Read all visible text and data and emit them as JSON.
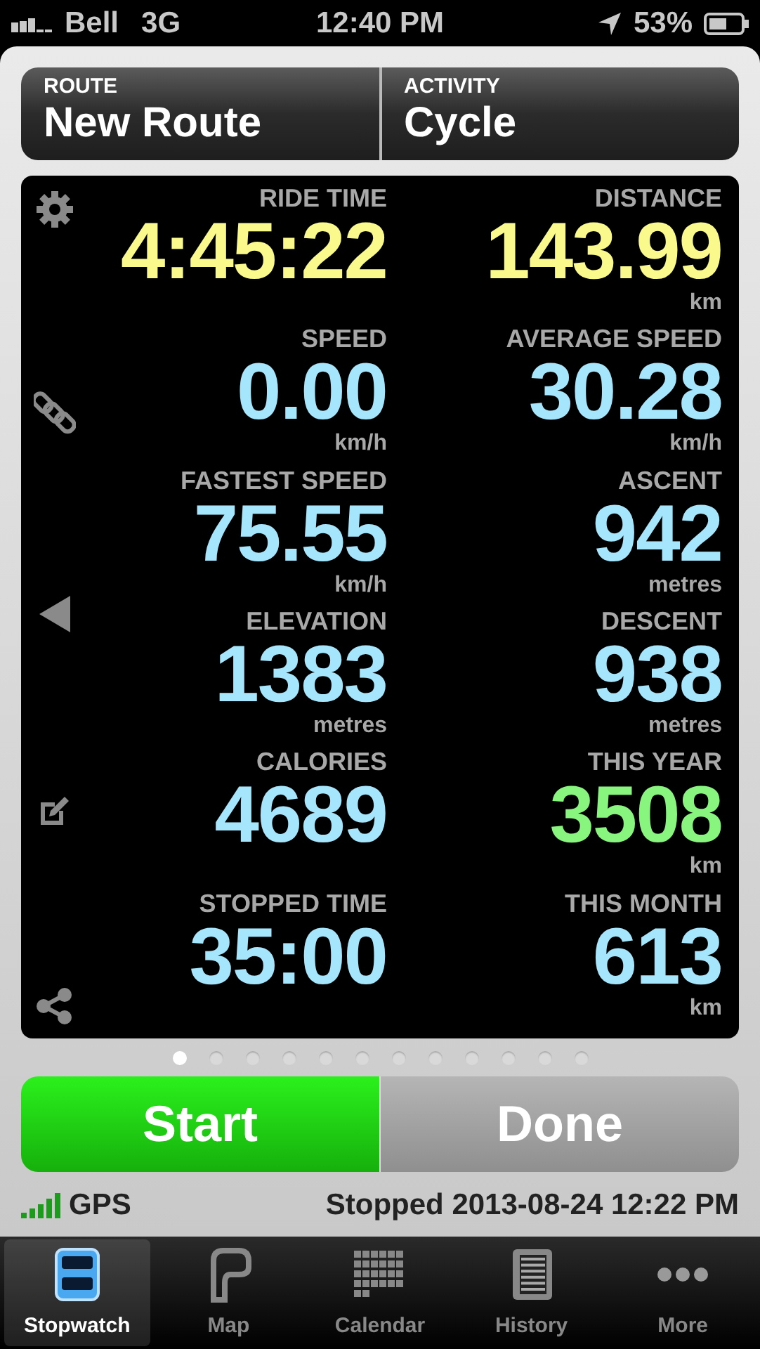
{
  "status_bar": {
    "carrier": "Bell",
    "network": "3G",
    "time": "12:40 PM",
    "battery": "53%"
  },
  "header": [
    {
      "label": "ROUTE",
      "value": "New Route"
    },
    {
      "label": "ACTIVITY",
      "value": "Cycle"
    }
  ],
  "metrics": [
    {
      "label": "RIDE TIME",
      "value": "4:45:22",
      "color": "#fafa8c"
    },
    {
      "label": "DISTANCE",
      "value": "143.99",
      "unit": "km",
      "color": "#fafa8c"
    },
    {
      "label": "SPEED",
      "value": "0.00",
      "unit": "km/h",
      "color": "#a6e6fc"
    },
    {
      "label": "AVERAGE SPEED",
      "value": "30.28",
      "unit": "km/h",
      "color": "#a6e6fc"
    },
    {
      "label": "FASTEST SPEED",
      "value": "75.55",
      "unit": "km/h",
      "color": "#a6e6fc"
    },
    {
      "label": "ASCENT",
      "value": "942",
      "unit": "metres",
      "color": "#a6e6fc"
    },
    {
      "label": "ELEVATION",
      "value": "1383",
      "unit": "metres",
      "color": "#a6e6fc"
    },
    {
      "label": "DESCENT",
      "value": "938",
      "unit": "metres",
      "color": "#a6e6fc"
    },
    {
      "label": "CALORIES",
      "value": "4689",
      "color": "#a6e6fc"
    },
    {
      "label": "THIS YEAR",
      "value": "3508",
      "unit": "km",
      "color": "#88f57e"
    },
    {
      "label": "STOPPED TIME",
      "value": "35:00",
      "color": "#a6e6fc"
    },
    {
      "label": "THIS MONTH",
      "value": "613",
      "unit": "km",
      "color": "#a6e6fc"
    }
  ],
  "page_dots": [
    {
      "selected": true
    },
    {
      "selected": false
    },
    {
      "selected": false
    },
    {
      "selected": false
    },
    {
      "selected": false
    },
    {
      "selected": false
    },
    {
      "selected": false
    },
    {
      "selected": false
    },
    {
      "selected": false
    },
    {
      "selected": false
    },
    {
      "selected": false
    },
    {
      "selected": false
    }
  ],
  "buttons": [
    {
      "label": "Start",
      "kind": "start"
    },
    {
      "label": "Done",
      "kind": "done"
    }
  ],
  "gps": {
    "label": "GPS",
    "status": "Stopped 2013-08-24 12:22 PM"
  },
  "tabs": [
    {
      "label": "Stopwatch",
      "kind": "stopwatch",
      "selected": true
    },
    {
      "label": "Map",
      "kind": "map",
      "selected": false
    },
    {
      "label": "Calendar",
      "kind": "calendar",
      "selected": false
    },
    {
      "label": "History",
      "kind": "history",
      "selected": false
    },
    {
      "label": "More",
      "kind": "more",
      "selected": false
    }
  ]
}
